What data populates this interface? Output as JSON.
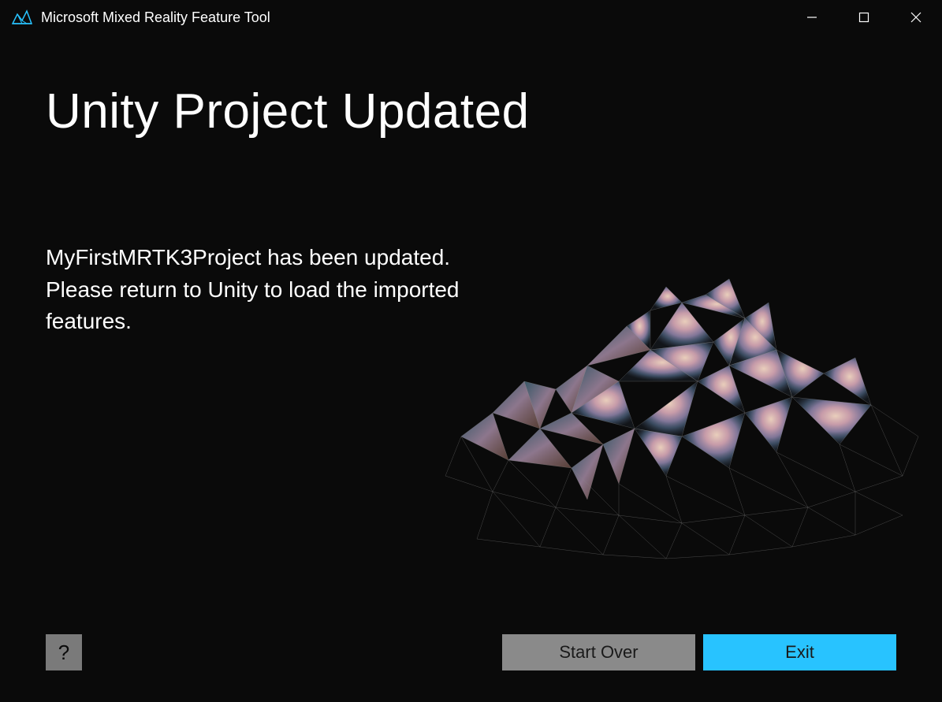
{
  "titlebar": {
    "title": "Microsoft Mixed Reality Feature Tool"
  },
  "main": {
    "heading": "Unity Project Updated",
    "description": "MyFirstMRTK3Project has been updated. Please return to Unity to load the imported features."
  },
  "footer": {
    "help_label": "?",
    "start_over_label": "Start Over",
    "exit_label": "Exit"
  },
  "colors": {
    "background": "#0a0a0a",
    "text": "#ffffff",
    "accent": "#28c3ff",
    "secondary": "#8a8a8a"
  }
}
